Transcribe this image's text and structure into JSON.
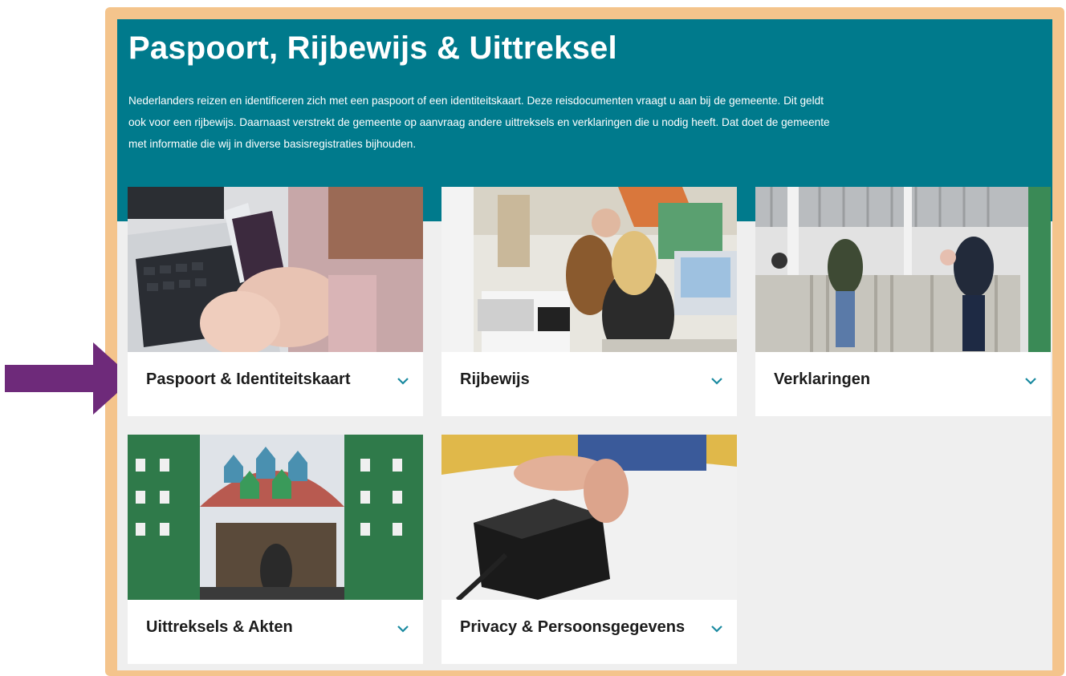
{
  "page": {
    "title": "Paspoort, Rijbewijs & Uittreksel",
    "intro": "Nederlanders reizen en identificeren zich met een paspoort of een identiteitskaart. Deze reisdocumenten vraagt u aan bij de gemeente. Dit geldt ook voor een rijbewijs. Daarnaast verstrekt de gemeente op aanvraag andere uittreksels en verklaringen die u nodig heeft. Dat doet de gemeente met informatie die wij in diverse basisregistraties bijhouden."
  },
  "cards": [
    {
      "label": "Paspoort & Identiteitskaart",
      "icon": "chevron-down-icon"
    },
    {
      "label": "Rijbewijs",
      "icon": "chevron-down-icon"
    },
    {
      "label": "Verklaringen",
      "icon": "chevron-down-icon"
    },
    {
      "label": "Uittreksels & Akten",
      "icon": "chevron-down-icon"
    },
    {
      "label": "Privacy & Persoonsgegevens",
      "icon": "chevron-down-icon"
    }
  ],
  "colors": {
    "frame": "#f4c48c",
    "hero": "#007a8c",
    "arrow": "#6e2a7a",
    "chevron": "#1a8aa0"
  },
  "annotation": {
    "icon": "arrow-right-icon"
  }
}
